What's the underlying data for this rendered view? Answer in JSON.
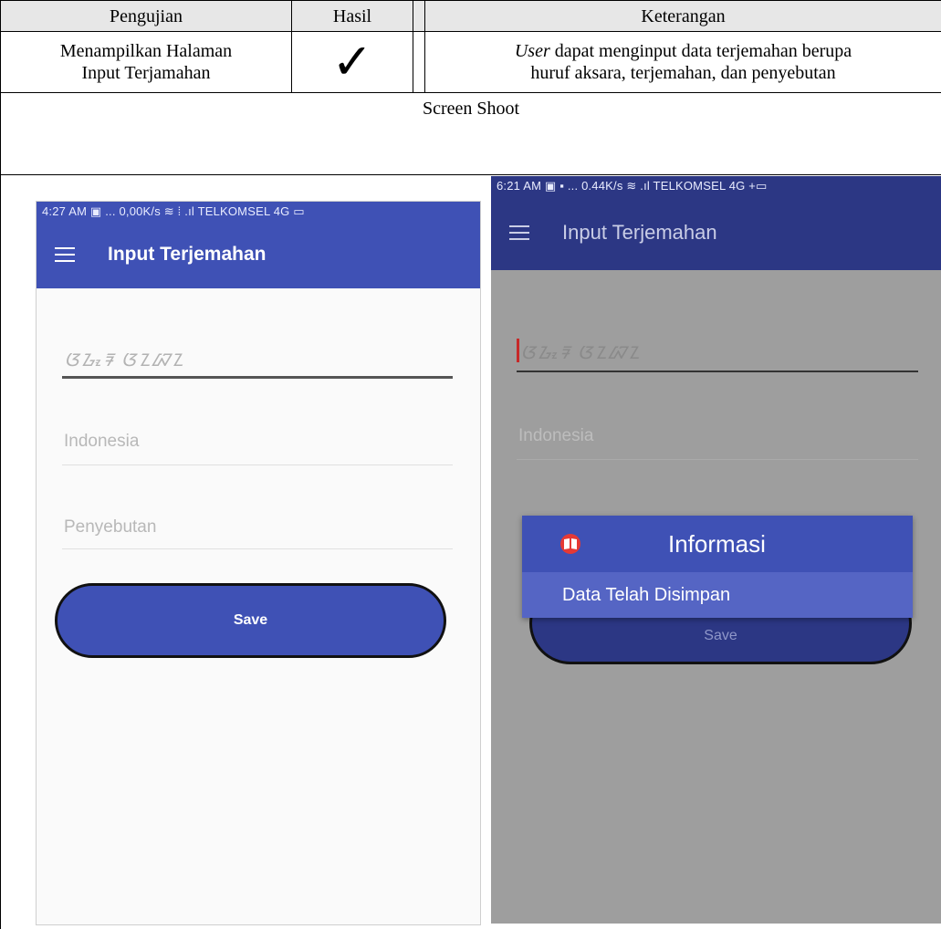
{
  "table": {
    "headers": {
      "pengujian": "Pengujian",
      "hasil": "Hasil",
      "keterangan": "Keterangan"
    },
    "row": {
      "pengujian_line1": "Menampilkan Halaman",
      "pengujian_line2": "Input Terjamahan",
      "hasil_mark": "✓",
      "keterangan_line1_italic": "User",
      "keterangan_line1_rest": " dapat menginput data terjemahan berupa",
      "keterangan_line2": "huruf aksara, terjemahan, dan penyebutan"
    },
    "screen_shoot_label": "Screen Shoot"
  },
  "phone_left": {
    "status": "4:27 AM ▣ ... 0,00K/s ≋ ⁞ .ıl TELKOMSEL 4G ▭",
    "title": "Input Terjemahan",
    "aksara_value": "ᮃᮌᮧᮛ ᮃᮔᮘᮔ",
    "hint_indonesia": "Indonesia",
    "hint_penyebutan": "Penyebutan",
    "save_label": "Save"
  },
  "phone_right": {
    "status": "6:21 AM ▣ ▪ ... 0.44K/s ≋ .ıl TELKOMSEL 4G +▭",
    "title": "Input Terjemahan",
    "aksara_value": "ᮃᮌᮧᮛ ᮃᮔᮘᮔ",
    "hint_indonesia": "Indonesia",
    "save_label": "Save",
    "dialog_title": "Informasi",
    "dialog_message": "Data Telah Disimpan"
  },
  "colors": {
    "primary": "#3f51b5",
    "dialog_body": "#5565c4",
    "dim": "#9e9e9e",
    "icon_red": "#e53935"
  }
}
